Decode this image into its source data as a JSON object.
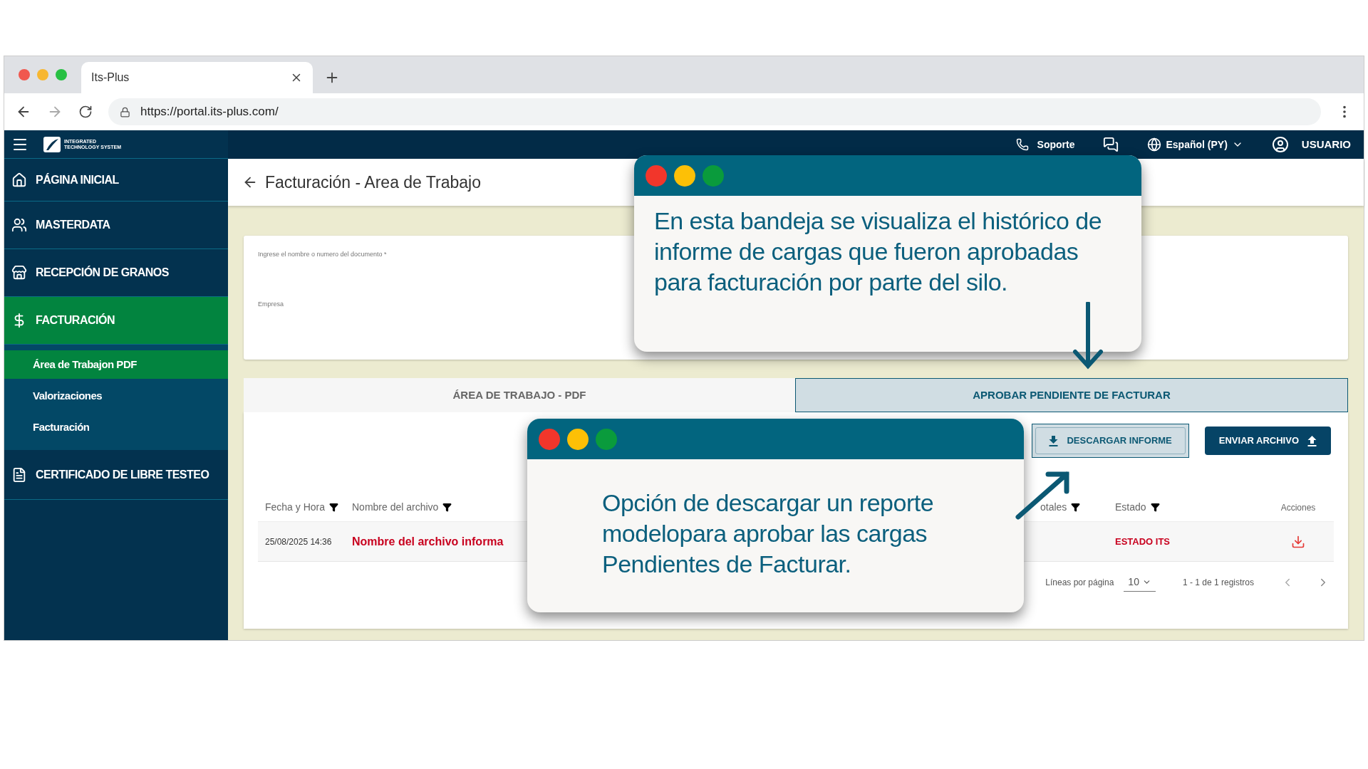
{
  "browser": {
    "tab_title": "Its-Plus",
    "url": "https://portal.its-plus.com/"
  },
  "header": {
    "logo_text": "INTEGRATED TECHNOLOGY SYSTEM",
    "support": "Soporte",
    "language": "Español (PY)",
    "user": "USUARIO"
  },
  "sidebar": {
    "items": [
      {
        "label": "PÁGINA INICIAL",
        "kind": "home",
        "selected": false
      },
      {
        "label": "MASTERDATA",
        "kind": "users",
        "selected": false
      },
      {
        "label": "RECEPCIÓN DE GRANOS",
        "kind": "store",
        "selected": false
      },
      {
        "label": "FACTURACIÓN",
        "kind": "money",
        "selected": true,
        "children": [
          {
            "label": "Área de Trabajon PDF",
            "selected": true
          },
          {
            "label": "Valorizaciones",
            "selected": false
          },
          {
            "label": "Facturación",
            "selected": false
          }
        ]
      },
      {
        "label": "CERTIFICADO DE LIBRE TESTEO",
        "kind": "document",
        "selected": false
      }
    ]
  },
  "page_title": "Facturación - Area de Trabajo",
  "search_form": {
    "fields": [
      {
        "label": "Ingrese el nombre o numero del documento *"
      },
      {
        "label": "Empresa"
      }
    ]
  },
  "tabs": [
    {
      "label": "ÁREA DE TRABAJO - PDF",
      "selected": false
    },
    {
      "label": "APROBAR PENDIENTE DE FACTURAR",
      "selected": true
    }
  ],
  "buttons": [
    {
      "label": "DESCARGAR INFORME",
      "kind": "download",
      "highlighted": true
    },
    {
      "label": "ENVIAR ARCHIVO",
      "kind": "upload",
      "highlighted": false
    }
  ],
  "table": {
    "columns": [
      "Fecha y Hora",
      "Nombre del archivo",
      "otales",
      "Estado",
      "Acciones"
    ],
    "rows": [
      {
        "date": "25/08/2025 14:36",
        "name": "Nombre del archivo informa",
        "status": "ESTADO ITS"
      }
    ]
  },
  "pagination": {
    "label": "Líneas por página",
    "page_size": "10",
    "range": "1 - 1 de 1 registros"
  },
  "callouts": [
    {
      "text": "En esta bandeja se visualiza el histórico de informe de cargas que fueron aprobadas para facturación por parte del silo."
    },
    {
      "text": "Opción de descargar un reporte modelopara aprobar las cargas Pendientes de Facturar."
    }
  ]
}
